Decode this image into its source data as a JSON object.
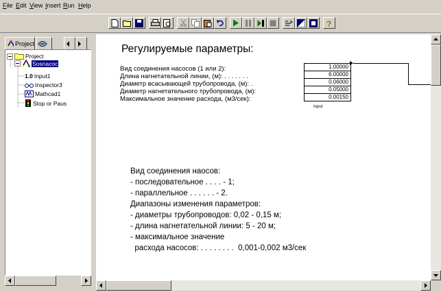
{
  "menu": {
    "file": "File",
    "edit": "Edit",
    "view": "View",
    "insert": "Insert",
    "run": "Run",
    "help": "Help"
  },
  "toolbar": {
    "buttons": [
      "new-doc-icon",
      "open-folder-icon",
      "save-icon",
      "print-icon",
      "print-preview-icon",
      "cut-icon",
      "copy-icon",
      "paste-icon",
      "undo-icon",
      "run-icon",
      "pause-icon",
      "step-icon",
      "stop-icon",
      "align-icon",
      "fill-color-icon",
      "fill-dark-icon",
      "help-icon"
    ]
  },
  "project_panel": {
    "tab_label": "Project",
    "tree": [
      {
        "label": "Project"
      },
      {
        "label": "Sosnacoc"
      },
      {
        "prefix": "1.0",
        "label": "Input1"
      },
      {
        "label": "Inspector3"
      },
      {
        "label": "Mathcad1"
      },
      {
        "label": "Stop or Paus"
      }
    ]
  },
  "document": {
    "heading": "Регулируемые параметры:",
    "params": [
      "Вид соединения насосов (1 или 2):",
      "Длина нагнетательной линии, (м): . . . . . . .",
      "Диаметр всасывающей трубопровода, (м): .",
      "Диаметр нагнетательного трубопровода, (м):",
      "Максимальное значение расхода, (м3/сек):"
    ],
    "inputs": [
      "1.00000",
      "6.00000",
      "0.06000",
      "0.05000",
      "0.00150"
    ],
    "input_caption": "Input",
    "description": [
      "Вид соединения наосов:",
      "- последовательное . . . . - 1;",
      "- параллельное . . . . . . - 2.",
      "Диапазоны изменения параметров:",
      "- диаметры трубопроводов:      0,02 - 0,15 м;",
      "- длина нагнетательной линии:  5 - 20 м;",
      "- максимальное значение",
      "  расхода насосов: . . . . . . . .  0,001-0,002 м3/сек"
    ]
  },
  "colors": {
    "chrome": "#d4d0c8",
    "selection": "#000080",
    "run_green": "#008000"
  }
}
